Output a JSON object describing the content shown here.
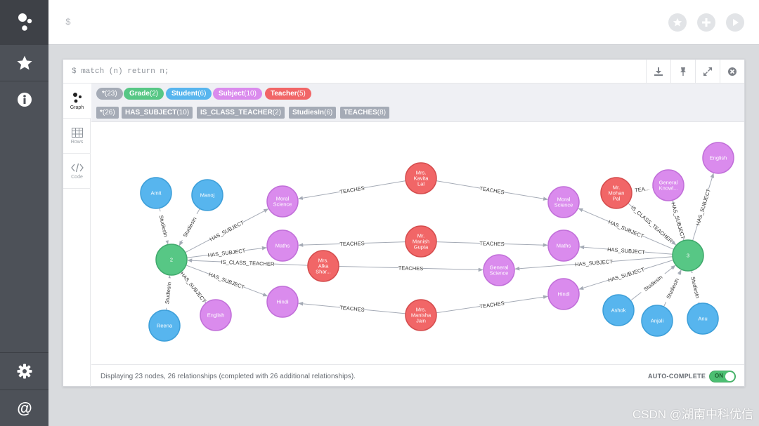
{
  "editor": {
    "prompt": "$"
  },
  "query": {
    "command": "$ match (n) return n;"
  },
  "view_tabs": [
    {
      "label": "Graph",
      "icon": "graph-icon",
      "active": true
    },
    {
      "label": "Rows",
      "icon": "table-icon",
      "active": false
    },
    {
      "label": "Code",
      "icon": "code-icon",
      "active": false
    }
  ],
  "node_labels": [
    {
      "name": "*",
      "count": "(23)",
      "color": "#a5abb6"
    },
    {
      "name": "Grade",
      "count": "(2)",
      "color": "#57c785"
    },
    {
      "name": "Student",
      "count": "(6)",
      "color": "#57b5ee"
    },
    {
      "name": "Subject",
      "count": "(10)",
      "color": "#da8bed"
    },
    {
      "name": "Teacher",
      "count": "(5)",
      "color": "#f16667"
    }
  ],
  "relationship_types": [
    {
      "name": "*",
      "count": "(26)"
    },
    {
      "name": "HAS_SUBJECT",
      "count": "(10)"
    },
    {
      "name": "IS_CLASS_TEACHER",
      "count": "(2)"
    },
    {
      "name": "StudiesIn",
      "count": "(6)"
    },
    {
      "name": "TEACHES",
      "count": "(8)"
    }
  ],
  "colors": {
    "grade": "#57c785",
    "student": "#57b5ee",
    "subject": "#da8bed",
    "teacher": "#f16667",
    "grade_stroke": "#40a96c",
    "student_stroke": "#3d9fd9",
    "subject_stroke": "#c16fd9",
    "teacher_stroke": "#d54d4e",
    "edge": "#a5abb6",
    "sidebar": "#4d5158"
  },
  "graph": {
    "nodes": {
      "amit": {
        "label": "Amit",
        "type": "student"
      },
      "manoj": {
        "label": "Manoj",
        "type": "student"
      },
      "reena": {
        "label": "Reena",
        "type": "student"
      },
      "ashok": {
        "label": "Ashok",
        "type": "student"
      },
      "anjali": {
        "label": "Anjali",
        "type": "student"
      },
      "anu": {
        "label": "Anu",
        "type": "student"
      },
      "g2": {
        "label": "2",
        "type": "grade"
      },
      "g3": {
        "label": "3",
        "type": "grade"
      },
      "ms_l": {
        "label": [
          "Moral",
          "Science"
        ],
        "type": "subject"
      },
      "math_l": {
        "label": "Maths",
        "type": "subject"
      },
      "hindi_l": {
        "label": "Hindi",
        "type": "subject"
      },
      "eng_l": {
        "label": "English",
        "type": "subject"
      },
      "ms_r": {
        "label": [
          "Moral",
          "Science"
        ],
        "type": "subject"
      },
      "math_r": {
        "label": "Maths",
        "type": "subject"
      },
      "hindi_r": {
        "label": "Hindi",
        "type": "subject"
      },
      "gs": {
        "label": [
          "General",
          "Science"
        ],
        "type": "subject"
      },
      "gk": {
        "label": [
          "General",
          "Knowl..."
        ],
        "type": "subject"
      },
      "eng_r": {
        "label": "English",
        "type": "subject"
      },
      "kavita": {
        "label": [
          "Mrs.",
          "Kavita",
          "Lal"
        ],
        "type": "teacher"
      },
      "manish": {
        "label": [
          "Mr.",
          "Manish",
          "Gupta"
        ],
        "type": "teacher"
      },
      "alka": {
        "label": [
          "Mrs.",
          "Alka",
          "Shar..."
        ],
        "type": "teacher"
      },
      "manisha": {
        "label": [
          "Mrs.",
          "Manisha",
          "Jain"
        ],
        "type": "teacher"
      },
      "mohan": {
        "label": [
          "Mr.",
          "Mohan",
          "Pal"
        ],
        "type": "teacher"
      }
    },
    "edges": [
      {
        "from": "amit",
        "to": "g2",
        "label": "StudiesIn"
      },
      {
        "from": "manoj",
        "to": "g2",
        "label": "StudiesIn"
      },
      {
        "from": "reena",
        "to": "g2",
        "label": "StudiesIn"
      },
      {
        "from": "g2",
        "to": "ms_l",
        "label": "HAS_SUBJECT"
      },
      {
        "from": "g2",
        "to": "math_l",
        "label": "HAS_SUBJECT"
      },
      {
        "from": "g2",
        "to": "hindi_l",
        "label": "HAS_SUBJECT"
      },
      {
        "from": "g2",
        "to": "eng_l",
        "label": "HAS_SUBJECT"
      },
      {
        "from": "alka",
        "to": "g2",
        "label": "IS_CLASS_TEACHER"
      },
      {
        "from": "alka",
        "to": "gs",
        "label": "TEACHES"
      },
      {
        "from": "kavita",
        "to": "ms_l",
        "label": "TEACHES"
      },
      {
        "from": "kavita",
        "to": "ms_r",
        "label": "TEACHES"
      },
      {
        "from": "manish",
        "to": "math_l",
        "label": "TEACHES"
      },
      {
        "from": "manish",
        "to": "math_r",
        "label": "TEACHES"
      },
      {
        "from": "manisha",
        "to": "hindi_l",
        "label": "TEACHES"
      },
      {
        "from": "manisha",
        "to": "hindi_r",
        "label": "TEACHES"
      },
      {
        "from": "mohan",
        "to": "gk",
        "label": "TEA..."
      },
      {
        "from": "mohan",
        "to": "g3",
        "label": "IS_CLASS_TEACHER"
      },
      {
        "from": "g3",
        "to": "ms_r",
        "label": "HAS_SUBJECT"
      },
      {
        "from": "g3",
        "to": "math_r",
        "label": "HAS_SUBJECT"
      },
      {
        "from": "g3",
        "to": "gs",
        "label": "HAS_SUBJECT"
      },
      {
        "from": "g3",
        "to": "hindi_r",
        "label": "HAS_SUBJECT"
      },
      {
        "from": "g3",
        "to": "gk",
        "label": "HAS_SUBJECT"
      },
      {
        "from": "g3",
        "to": "eng_r",
        "label": "HAS_SUBJECT"
      },
      {
        "from": "ashok",
        "to": "g3",
        "label": "StudiesIn"
      },
      {
        "from": "anjali",
        "to": "g3",
        "label": "StudiesIn"
      },
      {
        "from": "anu",
        "to": "g3",
        "label": "StudiesIn"
      }
    ]
  },
  "footer": {
    "status": "Displaying 23 nodes, 26 relationships (completed with 26 additional relationships).",
    "autocomplete_label": "AUTO-COMPLETE",
    "toggle_text": "ON"
  },
  "watermark": "CSDN @湖南中科优信"
}
